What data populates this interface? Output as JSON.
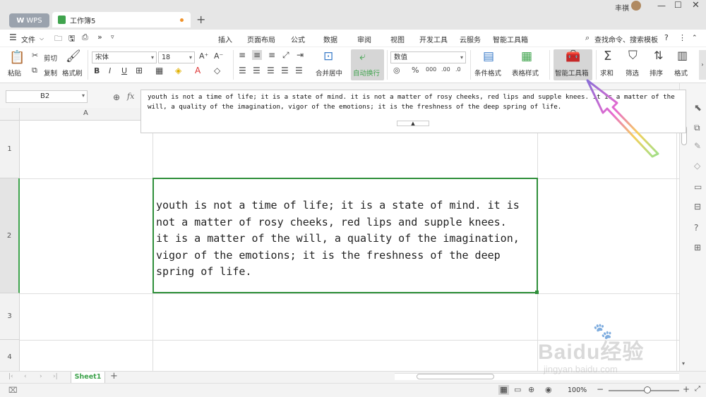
{
  "titlebar": {
    "wps_tab": "WPS",
    "doc_tab": "工作簿5",
    "user_name": "丰祺",
    "new_tab": "+"
  },
  "menu": {
    "file": "文件",
    "tabs": [
      "开始",
      "插入",
      "页面布局",
      "公式",
      "数据",
      "审阅",
      "视图",
      "开发工具",
      "云服务",
      "智能工具箱"
    ],
    "active_tab": "开始",
    "search_placeholder": "查找命令、搜索模板",
    "help": "?"
  },
  "ribbon": {
    "paste": "粘贴",
    "cut": "剪切",
    "copy": "复制",
    "format_painter": "格式刷",
    "font_name": "宋体",
    "font_size": "18",
    "merge_center": "合并居中",
    "wrap_text": "自动换行",
    "number_format": "数值",
    "conditional_format": "条件格式",
    "table_style": "表格样式",
    "smart_toolbox": "智能工具箱",
    "sum": "求和",
    "filter": "筛选",
    "sort": "排序",
    "format": "格式"
  },
  "formula_bar": {
    "name_box": "B2",
    "fx": "fx",
    "content": "youth is not a time of life; it is a state of mind. it is not a matter of rosy cheeks, red lips and supple knees. it is a matter of the will, a quality of the imagination, vigor of the emotions; it is the freshness of the deep spring of life."
  },
  "grid": {
    "col_a": "A",
    "rows": [
      "1",
      "2",
      "3",
      "4"
    ],
    "cell_b2_lines": [
      "youth is not a time of life; it is a state of mind. it is",
      "not a matter of rosy cheeks, red lips and supple knees.",
      "it is a matter of the will, a quality of the imagination,",
      "vigor of the emotions; it is the freshness of the deep",
      "spring of life."
    ]
  },
  "sheets": {
    "active": "Sheet1",
    "add": "+"
  },
  "status": {
    "zoom": "100%"
  },
  "watermark": {
    "brand": "Baidu经验",
    "url": "jingyan.baidu.com"
  },
  "colors": {
    "accent_green": "#3fa34d",
    "selection_border": "#2f8f3a",
    "arrow_stroke": "#8a6fd6"
  }
}
